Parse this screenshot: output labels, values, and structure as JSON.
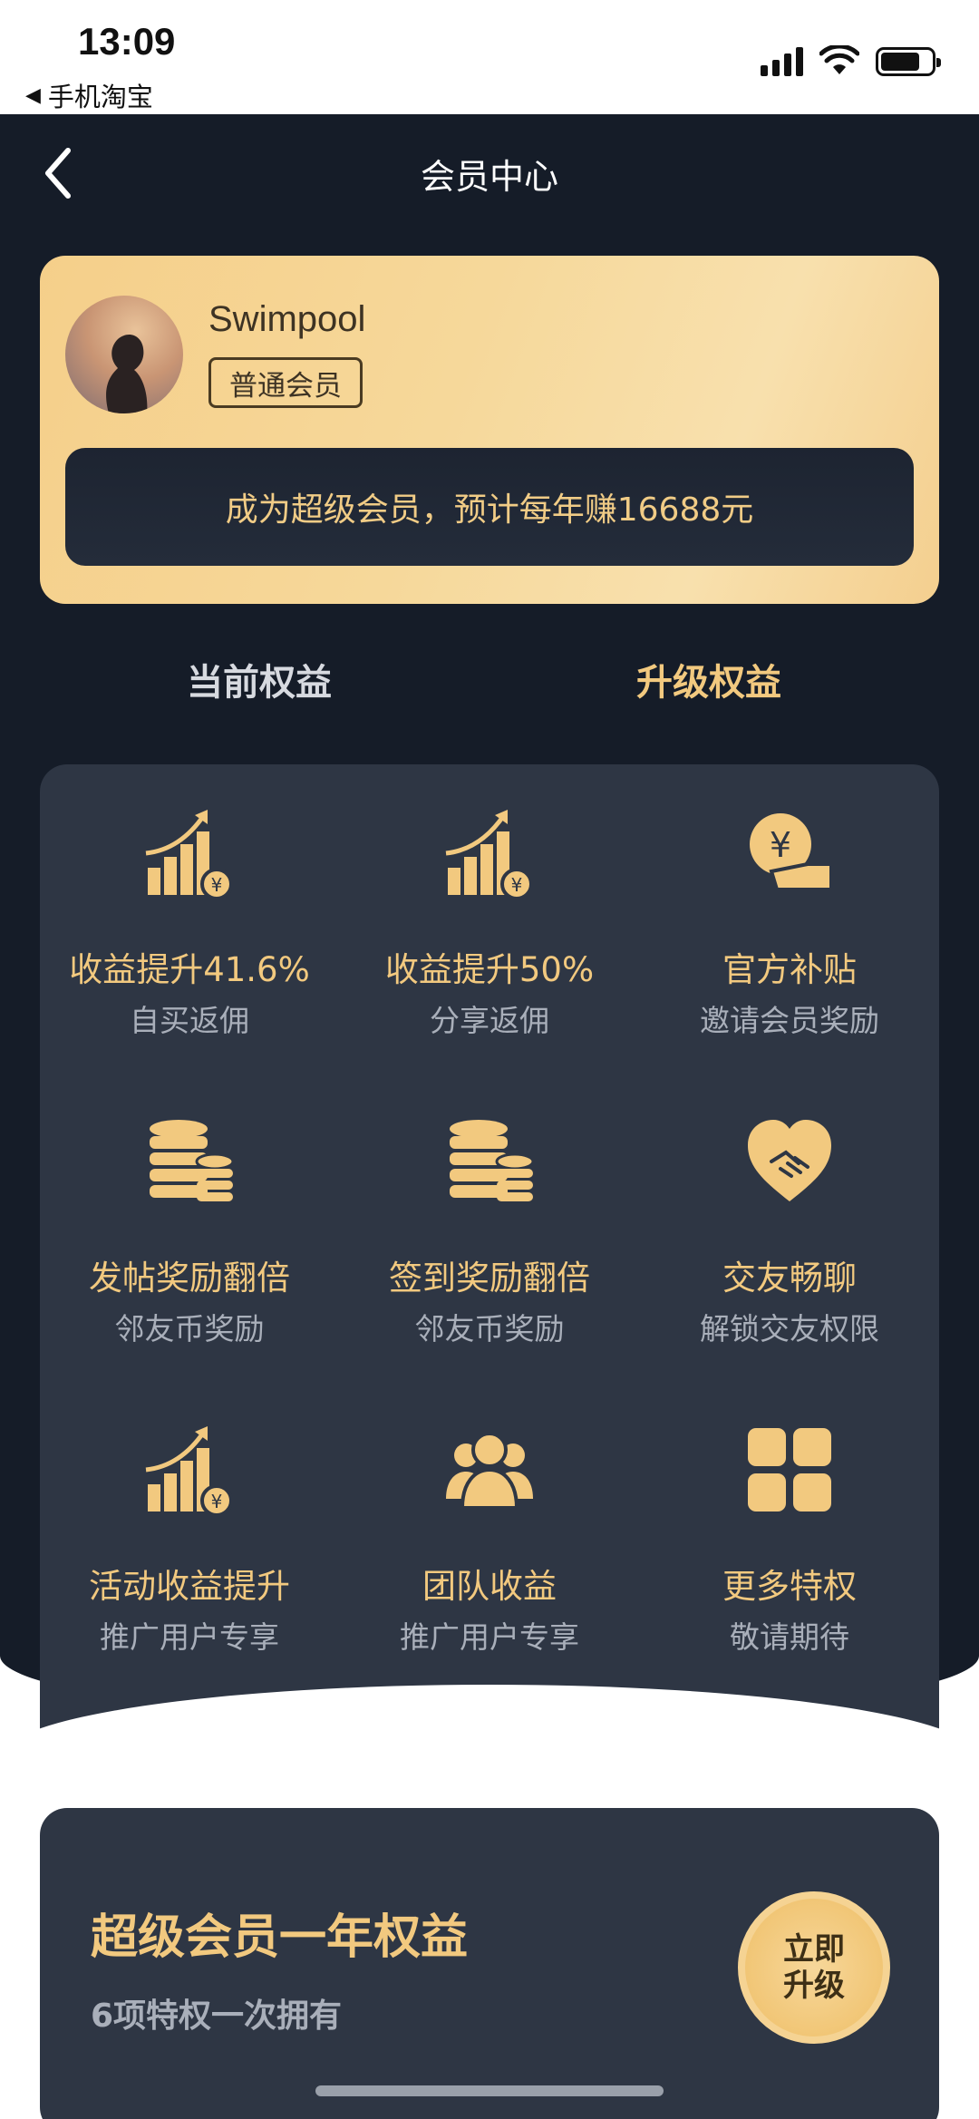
{
  "status_bar": {
    "time": "13:09",
    "back_app": "手机淘宝"
  },
  "nav": {
    "title": "会员中心"
  },
  "profile": {
    "username": "Swimpool",
    "level": "普通会员",
    "promo": "成为超级会员，预计每年赚16688元"
  },
  "tabs": {
    "current": "当前权益",
    "upgrade": "升级权益"
  },
  "benefits": [
    {
      "icon": "growth-chart-icon",
      "title": "收益提升41.6%",
      "subtitle": "自买返佣"
    },
    {
      "icon": "growth-chart-icon",
      "title": "收益提升50%",
      "subtitle": "分享返佣"
    },
    {
      "icon": "yuan-coin-hand-icon",
      "title": "官方补贴",
      "subtitle": "邀请会员奖励"
    },
    {
      "icon": "coin-stack-icon",
      "title": "发帖奖励翻倍",
      "subtitle": "邻友币奖励"
    },
    {
      "icon": "coin-stack-icon",
      "title": "签到奖励翻倍",
      "subtitle": "邻友币奖励"
    },
    {
      "icon": "handshake-heart-icon",
      "title": "交友畅聊",
      "subtitle": "解锁交友权限"
    },
    {
      "icon": "growth-chart-icon",
      "title": "活动收益提升",
      "subtitle": "推广用户专享"
    },
    {
      "icon": "team-icon",
      "title": "团队收益",
      "subtitle": "推广用户专享"
    },
    {
      "icon": "grid-apps-icon",
      "title": "更多特权",
      "subtitle": "敬请期待"
    }
  ],
  "upgrade_card": {
    "title": "超级会员一年权益",
    "subtitle": "6项特权一次拥有",
    "button_line1": "立即",
    "button_line2": "升级"
  },
  "colors": {
    "dark_bg": "#151c28",
    "panel": "#2e3644",
    "gold": "#f2c97f"
  }
}
